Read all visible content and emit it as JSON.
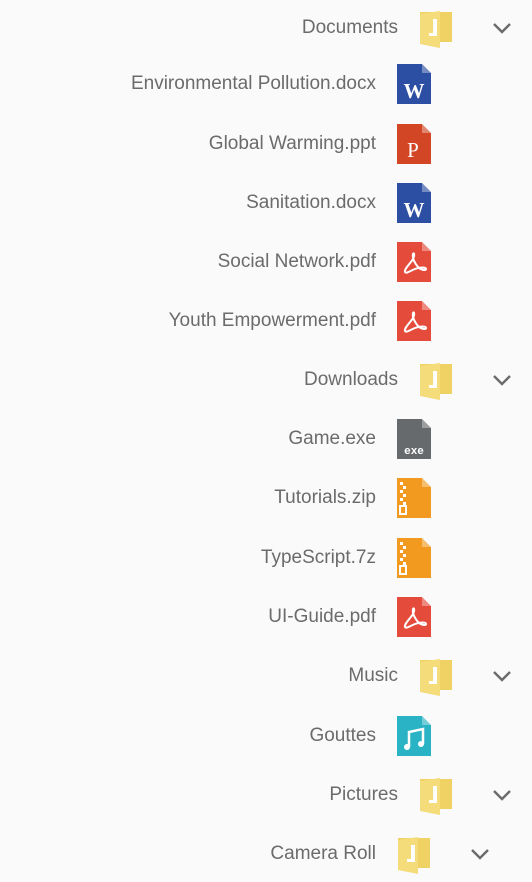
{
  "tree": [
    {
      "label": "Documents",
      "type": "folder",
      "expanded": true,
      "level": 0,
      "icon": "folder-icon",
      "color": "#efd164"
    },
    {
      "label": "Environmental Pollution.docx",
      "type": "file",
      "level": 1,
      "icon": "word-file-icon",
      "glyph": "W",
      "color": "#2c4fa3"
    },
    {
      "label": "Global Warming.ppt",
      "type": "file",
      "level": 1,
      "icon": "powerpoint-file-icon",
      "glyph": "P",
      "color": "#d24625"
    },
    {
      "label": "Sanitation.docx",
      "type": "file",
      "level": 1,
      "icon": "word-file-icon",
      "glyph": "W",
      "color": "#2c4fa3"
    },
    {
      "label": "Social Network.pdf",
      "type": "file",
      "level": 1,
      "icon": "pdf-file-icon",
      "glyph": "pdf",
      "color": "#e44b3b"
    },
    {
      "label": "Youth Empowerment.pdf",
      "type": "file",
      "level": 1,
      "icon": "pdf-file-icon",
      "glyph": "pdf",
      "color": "#e44b3b"
    },
    {
      "label": "Downloads",
      "type": "folder",
      "expanded": true,
      "level": 0,
      "icon": "folder-icon",
      "color": "#efd164"
    },
    {
      "label": "Game.exe",
      "type": "file",
      "level": 1,
      "icon": "exe-file-icon",
      "glyph": "exe",
      "color": "#676a6d"
    },
    {
      "label": "Tutorials.zip",
      "type": "file",
      "level": 1,
      "icon": "zip-file-icon",
      "glyph": "zip",
      "color": "#f29a1f"
    },
    {
      "label": "TypeScript.7z",
      "type": "file",
      "level": 1,
      "icon": "zip-file-icon",
      "glyph": "zip",
      "color": "#f29a1f"
    },
    {
      "label": "UI-Guide.pdf",
      "type": "file",
      "level": 1,
      "icon": "pdf-file-icon",
      "glyph": "pdf",
      "color": "#e44b3b"
    },
    {
      "label": "Music",
      "type": "folder",
      "expanded": true,
      "level": 0,
      "icon": "folder-icon",
      "color": "#efd164"
    },
    {
      "label": "Gouttes",
      "type": "file",
      "level": 1,
      "icon": "audio-file-icon",
      "glyph": "music",
      "color": "#2ab3c4"
    },
    {
      "label": "Pictures",
      "type": "folder",
      "expanded": true,
      "level": 0,
      "icon": "folder-icon",
      "color": "#efd164"
    },
    {
      "label": "Camera Roll",
      "type": "folder",
      "expanded": false,
      "level": 1,
      "icon": "folder-icon",
      "color": "#efd164"
    }
  ]
}
